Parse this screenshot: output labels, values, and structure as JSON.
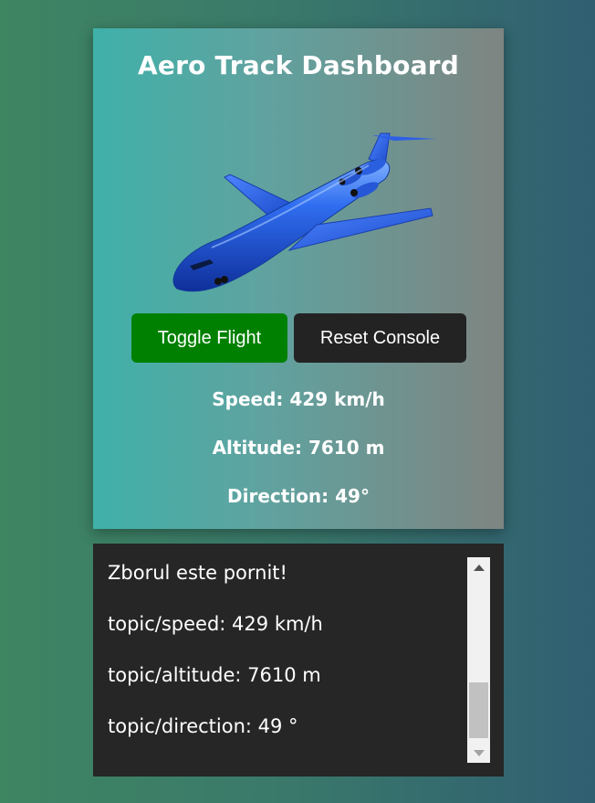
{
  "dashboard": {
    "title": "Aero Track Dashboard",
    "toggle_label": "Toggle Flight",
    "reset_label": "Reset Console",
    "speed_text": "Speed: 429 km/h",
    "altitude_text": "Altitude: 7610 m",
    "direction_text": "Direction: 49°",
    "plane_image": "airplane-icon"
  },
  "console": {
    "lines": [
      "Zborul este pornit!",
      "topic/speed: 429 km/h",
      "topic/altitude: 7610 m",
      "topic/direction: 49 °"
    ]
  },
  "colors": {
    "toggle_button": "#008000",
    "reset_button": "#232323",
    "console_background": "#262626",
    "card_gradient_start": "#3fb1a9",
    "card_gradient_end": "#7e8581"
  }
}
